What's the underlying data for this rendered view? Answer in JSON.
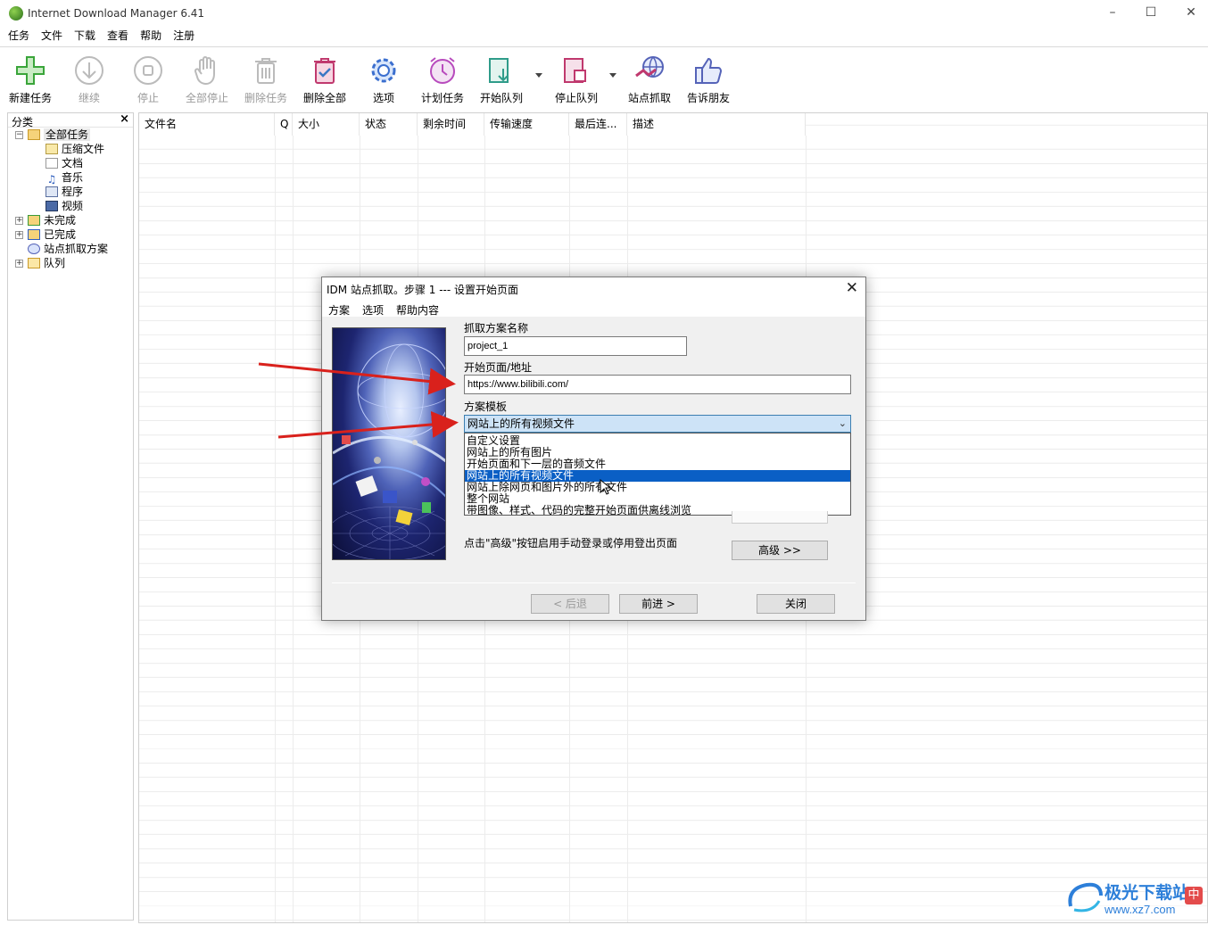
{
  "window": {
    "title": "Internet Download Manager 6.41",
    "controls": [
      "minimize",
      "maximize",
      "close"
    ]
  },
  "menu": [
    "任务",
    "文件",
    "下载",
    "查看",
    "帮助",
    "注册"
  ],
  "toolbar": [
    {
      "label": "新建任务",
      "icon": "plus-icon",
      "enabled": true
    },
    {
      "label": "继续",
      "icon": "resume-icon",
      "enabled": false
    },
    {
      "label": "停止",
      "icon": "stop-icon",
      "enabled": false
    },
    {
      "label": "全部停止",
      "icon": "hand-icon",
      "enabled": false
    },
    {
      "label": "删除任务",
      "icon": "trash-icon",
      "enabled": false
    },
    {
      "label": "删除全部",
      "icon": "trash-check-icon",
      "enabled": true
    },
    {
      "label": "选项",
      "icon": "gear-icon",
      "enabled": true
    },
    {
      "label": "计划任务",
      "icon": "alarm-clock-icon",
      "enabled": true
    },
    {
      "label": "开始队列",
      "icon": "queue-start-icon",
      "enabled": true
    },
    {
      "label": "停止队列",
      "icon": "queue-stop-icon",
      "enabled": true
    },
    {
      "label": "站点抓取",
      "icon": "site-grabber-icon",
      "enabled": true
    },
    {
      "label": "告诉朋友",
      "icon": "thumbs-up-icon",
      "enabled": true
    }
  ],
  "sidebar": {
    "title": "分类",
    "close": "×",
    "items": [
      {
        "label": "全部任务",
        "icon": "folder-open-icon"
      },
      {
        "label": "压缩文件",
        "icon": "archive-icon"
      },
      {
        "label": "文档",
        "icon": "document-icon"
      },
      {
        "label": "音乐",
        "icon": "music-icon"
      },
      {
        "label": "程序",
        "icon": "program-icon"
      },
      {
        "label": "视频",
        "icon": "video-icon"
      },
      {
        "label": "未完成",
        "icon": "folder-incomplete-icon"
      },
      {
        "label": "已完成",
        "icon": "folder-complete-icon"
      },
      {
        "label": "站点抓取方案",
        "icon": "site-grab-icon"
      },
      {
        "label": "队列",
        "icon": "folder-queue-icon"
      }
    ]
  },
  "columns": [
    "文件名",
    "Q",
    "大小",
    "状态",
    "剩余时间",
    "传输速度",
    "最后连...",
    "描述"
  ],
  "dialog": {
    "title": "IDM 站点抓取。步骤 1 --- 设置开始页面",
    "menu": [
      "方案",
      "选项",
      "帮助内容"
    ],
    "project_name_label": "抓取方案名称",
    "project_name_value": "project_1",
    "start_page_label": "开始页面/地址",
    "start_page_value": "https://www.bilibili.com/",
    "template_label": "方案模板",
    "template_selected": "网站上的所有视频文件",
    "template_options": [
      "自定义设置",
      "网站上的所有图片",
      "开始页面和下一层的音频文件",
      "网站上的所有视频文件",
      "网站上除网页和图片外的所有文件",
      "整个网站",
      "带图像、样式、代码的完整开始页面供离线浏览"
    ],
    "selected_index": 3,
    "hint": "点击\"高级\"按钮启用手动登录或停用登出页面",
    "advanced_button": "高级 >>",
    "back_button": "< 后退",
    "next_button": "前进 >",
    "close_button": "关闭"
  },
  "watermark": {
    "text": "极光下载站",
    "url": "www.xz7.com",
    "ime": "中"
  },
  "colors": {
    "accent": "#0a5fc5",
    "arrow": "#d9211c",
    "combo_bg": "#cde3f7"
  }
}
